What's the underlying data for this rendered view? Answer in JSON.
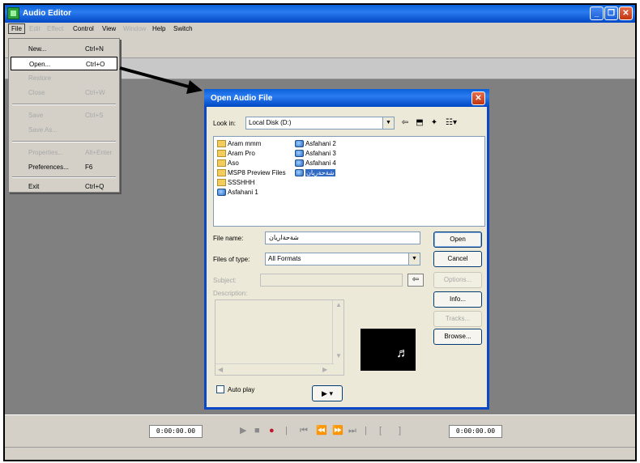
{
  "main_window": {
    "title": "Audio Editor",
    "min_glyph": "_",
    "max_glyph": "❐",
    "close_glyph": "✕"
  },
  "menubar": {
    "items": [
      "File",
      "Edit",
      "Effect",
      "Control",
      "View",
      "Window",
      "Help",
      "Switch"
    ]
  },
  "file_menu": {
    "items": [
      {
        "label": "New...",
        "shortcut": "Ctrl+N"
      },
      {
        "label": "Open...",
        "shortcut": "Ctrl+O"
      },
      {
        "label": "Restore",
        "shortcut": ""
      },
      {
        "label": "Close",
        "shortcut": "Ctrl+W"
      },
      {
        "label": "Save",
        "shortcut": "Ctrl+S"
      },
      {
        "label": "Save As...",
        "shortcut": ""
      },
      {
        "label": "Properties...",
        "shortcut": "Alt+Enter"
      },
      {
        "label": "Preferences...",
        "shortcut": "F6"
      },
      {
        "label": "Exit",
        "shortcut": "Ctrl+Q"
      }
    ]
  },
  "dialog": {
    "title": "Open Audio File",
    "close_glyph": "✕",
    "look_in_label": "Look in:",
    "look_in_value": "Local Disk (D:)",
    "files": [
      {
        "name": "Aram mmm",
        "type": "folder"
      },
      {
        "name": "Aram Pro",
        "type": "folder"
      },
      {
        "name": "Aso",
        "type": "folder"
      },
      {
        "name": "MSP8 Preview Files",
        "type": "folder"
      },
      {
        "name": "SSSHHH",
        "type": "folder"
      },
      {
        "name": "Asfahani 1",
        "type": "audio"
      },
      {
        "name": "Asfahani 2",
        "type": "audio"
      },
      {
        "name": "Asfahani 3",
        "type": "audio"
      },
      {
        "name": "Asfahani 4",
        "type": "audio"
      },
      {
        "name": "شةحةريان",
        "type": "audio"
      }
    ],
    "file_name_label": "File name:",
    "file_name_value": "شةحةاريان",
    "files_of_type_label": "Files of type:",
    "files_of_type_value": "All Formats",
    "subject_label": "Subject:",
    "description_label": "Description:",
    "buttons": {
      "open": "Open",
      "cancel": "Cancel",
      "options": "Options...",
      "info": "Info...",
      "tracks": "Tracks...",
      "browse": "Browse..."
    },
    "autoplay_label": "Auto play",
    "play_glyph": "▶ ▾"
  },
  "transport": {
    "left_time": "0:00:00.00",
    "right_time": "0:00:00.00"
  }
}
